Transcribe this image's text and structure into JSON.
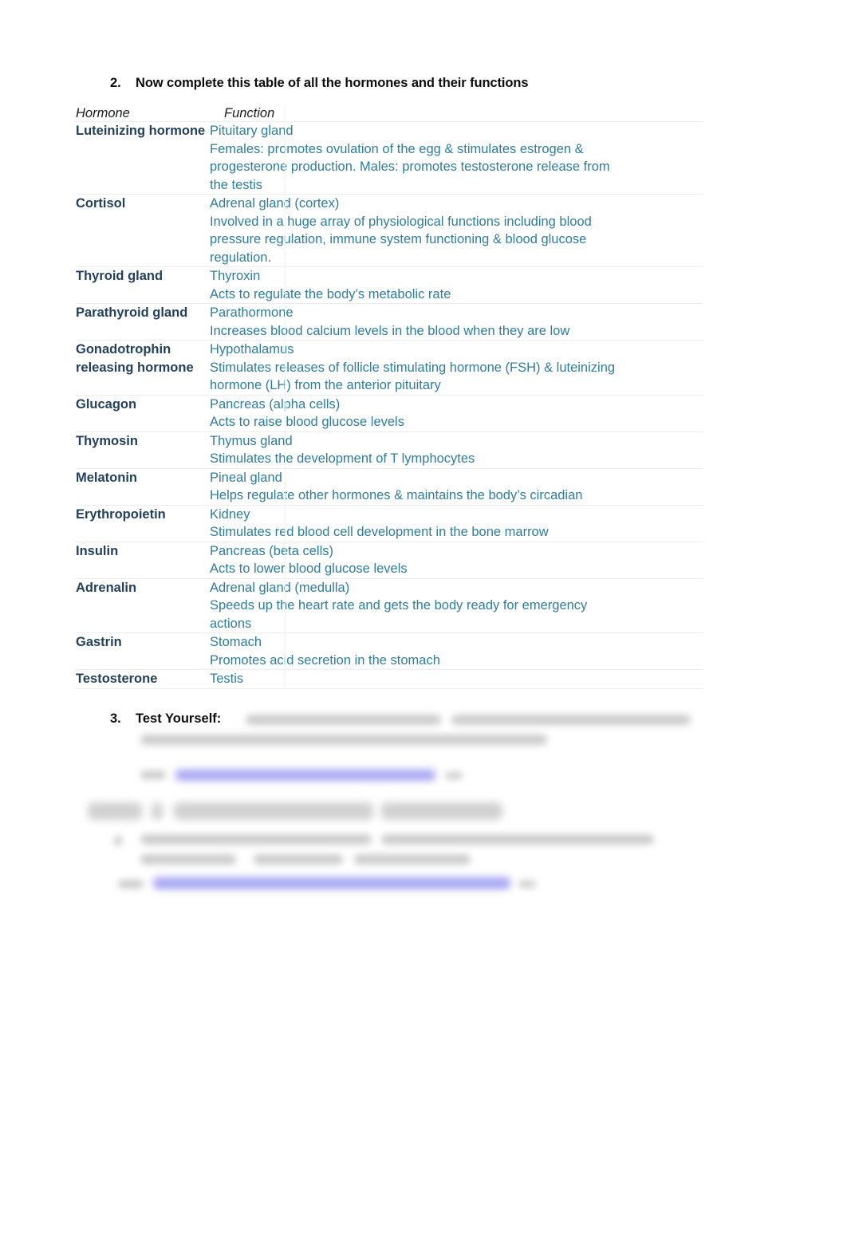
{
  "document": {
    "question2": {
      "number": "2.",
      "text": "Now complete this table of all the hormones and their functions"
    },
    "question3": {
      "number": "3.",
      "text": "Test Yourself:"
    }
  },
  "colors": {
    "hormone_name": "#23405c",
    "hormone_function": "#2e7d9c",
    "heading": "#0d0d0d",
    "row_divider": "#eceff1",
    "link": "#8f8ff0"
  },
  "table": {
    "headers": {
      "hormone": "Hormone",
      "function": "Function"
    },
    "rows": [
      {
        "hormone": "Luteinizing hormone",
        "function_lines": [
          "Pituitary gland",
          "Females: promotes ovulation of the egg & stimulates estrogen &",
          "progesterone production. Males: promotes testosterone release from",
          "the testis"
        ]
      },
      {
        "hormone": "Cortisol",
        "function_lines": [
          "Adrenal gland (cortex)",
          "Involved in a huge array of physiological functions including blood",
          "pressure regulation, immune system functioning & blood glucose",
          "regulation."
        ]
      },
      {
        "hormone": "Thyroid gland",
        "function_lines": [
          "Thyroxin",
          "Acts to regulate the body’s metabolic rate"
        ]
      },
      {
        "hormone": "Parathyroid gland",
        "function_lines": [
          "Parathormone",
          "Increases blood calcium levels in the blood when they are low"
        ]
      },
      {
        "hormone": "Gonadotrophin releasing hormone",
        "function_lines": [
          "Hypothalamus",
          "Stimulates releases of follicle stimulating hormone (FSH) & luteinizing",
          "hormone (LH) from the anterior pituitary"
        ]
      },
      {
        "hormone": "Glucagon",
        "function_lines": [
          "Pancreas (alpha cells)",
          "Acts to raise blood glucose levels"
        ]
      },
      {
        "hormone": "Thymosin",
        "function_lines": [
          "Thymus gland",
          "Stimulates the development of T lymphocytes"
        ]
      },
      {
        "hormone": "Melatonin",
        "function_lines": [
          "Pineal gland",
          "Helps regulate other hormones & maintains the body’s circadian"
        ]
      },
      {
        "hormone": "Erythropoietin",
        "function_lines": [
          "Kidney",
          "Stimulates red blood cell development in the bone marrow"
        ]
      },
      {
        "hormone": "Insulin",
        "function_lines": [
          "Pancreas (beta cells)",
          "Acts to lower blood glucose levels"
        ]
      },
      {
        "hormone": "Adrenalin",
        "function_lines": [
          "Adrenal gland (medulla)",
          "Speeds up the heart rate and gets the body ready for emergency",
          "actions"
        ]
      },
      {
        "hormone": "Gastrin",
        "function_lines": [
          "Stomach",
          "Promotes acid secretion in the stomach"
        ]
      },
      {
        "hormone": "Testosterone",
        "function_lines": [
          "Testis"
        ]
      }
    ]
  }
}
